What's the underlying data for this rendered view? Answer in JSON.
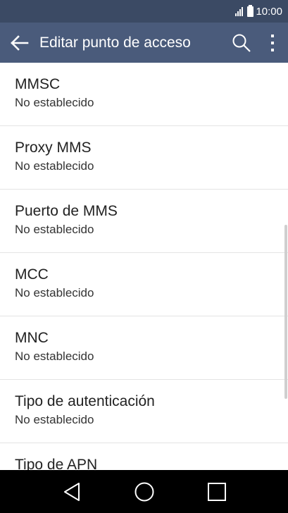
{
  "status_bar": {
    "time": "10:00",
    "icons": [
      "signal-icon",
      "battery-icon"
    ]
  },
  "app_bar": {
    "title": "Editar punto de acceso",
    "icons": [
      "back-arrow-icon",
      "search-icon",
      "more-vert-icon"
    ]
  },
  "list": {
    "items": [
      {
        "label": "MMSC",
        "value": "No establecido"
      },
      {
        "label": "Proxy MMS",
        "value": "No establecido"
      },
      {
        "label": "Puerto de MMS",
        "value": "No establecido"
      },
      {
        "label": "MCC",
        "value": "No establecido"
      },
      {
        "label": "MNC",
        "value": "No establecido"
      },
      {
        "label": "Tipo de autenticación",
        "value": "No establecido"
      },
      {
        "label": "Tipo de APN",
        "value": ""
      }
    ]
  },
  "nav_bar": {
    "icons": [
      "back-triangle-icon",
      "home-circle-icon",
      "recents-square-icon"
    ]
  },
  "colors": {
    "status_bar_bg": "#3b4a64",
    "app_bar_bg": "#4a5b7b",
    "nav_bar_bg": "#000000"
  }
}
